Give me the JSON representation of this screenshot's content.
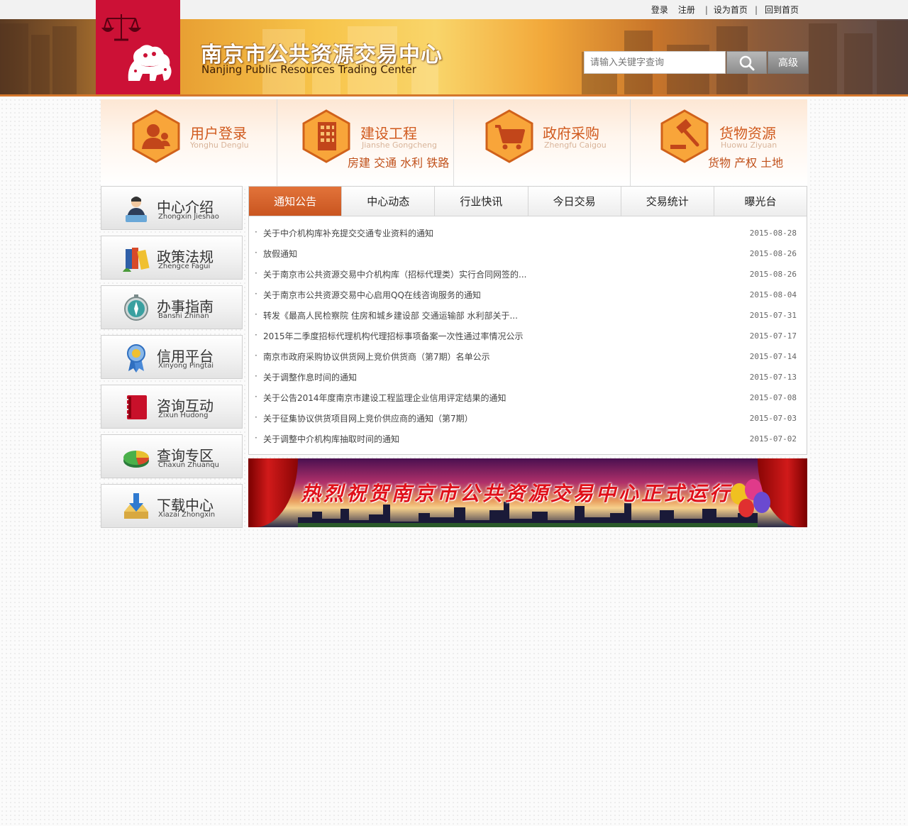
{
  "top_links": {
    "login": "登录",
    "register": "注册",
    "set_home": "设为首页",
    "back_home": "回到首页"
  },
  "header": {
    "title": "南京市公共资源交易中心",
    "subtitle": "Nanjing Public Resources Trading Center",
    "search_placeholder": "请输入关键字查询",
    "advanced_label": "高级",
    "logo_color": "#cc1136"
  },
  "categories": [
    {
      "title": "用户登录",
      "pinyin": "Yonghu Denglu",
      "extra": "",
      "icon": "user-icon"
    },
    {
      "title": "建设工程",
      "pinyin": "Jianshe Gongcheng",
      "extra": "房建 交通 水利 铁路",
      "icon": "building-icon"
    },
    {
      "title": "政府采购",
      "pinyin": "Zhengfu Caigou",
      "extra": "",
      "icon": "cart-icon"
    },
    {
      "title": "货物资源",
      "pinyin": "Huowu Ziyuan",
      "extra": "货物  产权  土地",
      "icon": "gavel-icon"
    }
  ],
  "sidebar": [
    {
      "title": "中心介绍",
      "pinyin": "Zhongxin Jieshao",
      "icon": "person-icon"
    },
    {
      "title": "政策法规",
      "pinyin": "Zhengce Fagui",
      "icon": "books-icon"
    },
    {
      "title": "办事指南",
      "pinyin": "Banshi Zhinan",
      "icon": "compass-icon"
    },
    {
      "title": "信用平台",
      "pinyin": "Xinyong Pingtai",
      "icon": "medal-icon"
    },
    {
      "title": "咨询互动",
      "pinyin": "Zixun Hudong",
      "icon": "notebook-icon"
    },
    {
      "title": "查询专区",
      "pinyin": "Chaxun Zhuanqu",
      "icon": "pie-chart-icon"
    },
    {
      "title": "下载中心",
      "pinyin": "Xiazai Zhongxin",
      "icon": "download-icon"
    }
  ],
  "tabs": [
    "通知公告",
    "中心动态",
    "行业快讯",
    "今日交易",
    "交易统计",
    "曝光台"
  ],
  "active_tab": "通知公告",
  "news": [
    {
      "title": "关于中介机构库补充提交交通专业资料的通知",
      "date": "2015-08-28"
    },
    {
      "title": "放假通知",
      "date": "2015-08-26"
    },
    {
      "title": "关于南京市公共资源交易中介机构库（招标代理类）实行合同网签的...",
      "date": "2015-08-26"
    },
    {
      "title": "关于南京市公共资源交易中心启用QQ在线咨询服务的通知",
      "date": "2015-08-04"
    },
    {
      "title": "转发《最高人民检察院 住房和城乡建设部 交通运输部 水利部关于...",
      "date": "2015-07-31"
    },
    {
      "title": "2015年二季度招标代理机构代理招标事项备案一次性通过率情况公示",
      "date": "2015-07-17"
    },
    {
      "title": "南京市政府采购协议供货网上竞价供货商（第7期）名单公示",
      "date": "2015-07-14"
    },
    {
      "title": "关于调整作息时间的通知",
      "date": "2015-07-13"
    },
    {
      "title": "关于公告2014年度南京市建设工程监理企业信用评定结果的通知",
      "date": "2015-07-08"
    },
    {
      "title": "关于征集协议供货项目网上竞价供应商的通知（第7期）",
      "date": "2015-07-03"
    },
    {
      "title": "关于调整中介机构库抽取时间的通知",
      "date": "2015-07-02"
    }
  ],
  "banner_text": "热烈祝贺南京市公共资源交易中心正式运行！"
}
